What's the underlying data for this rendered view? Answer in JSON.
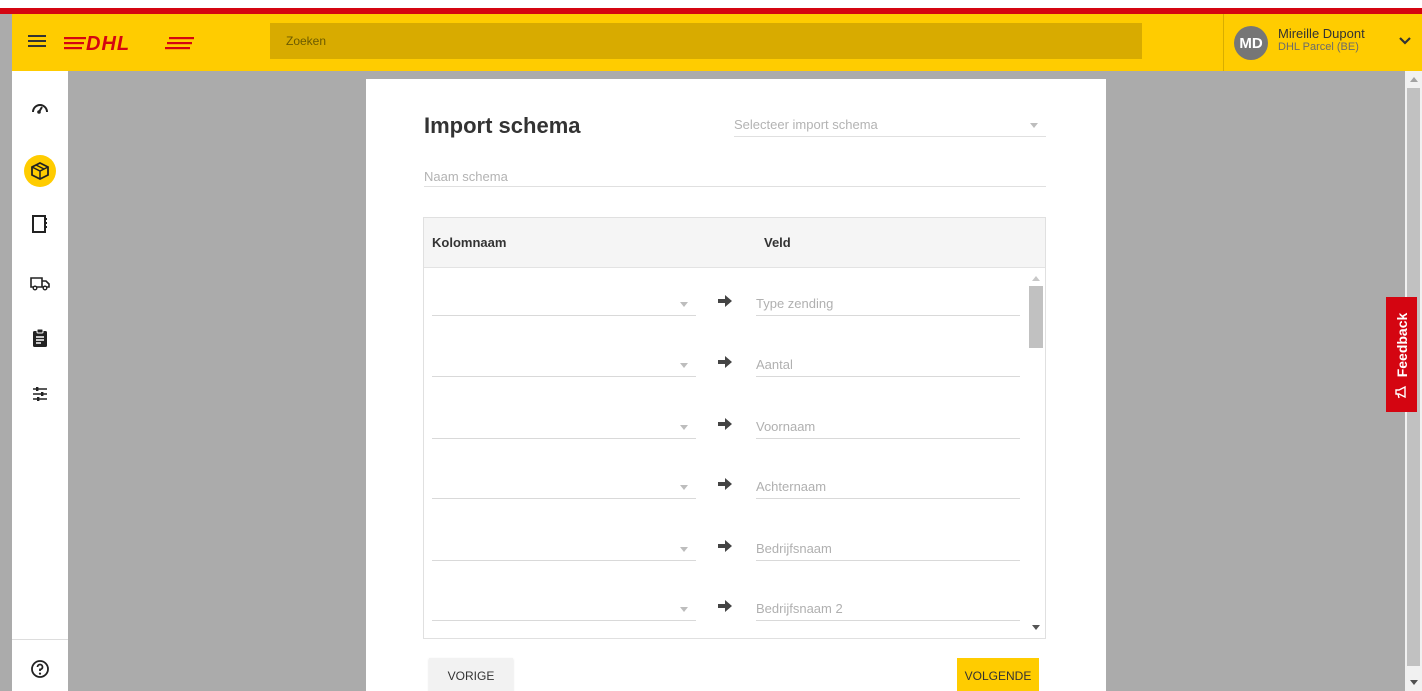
{
  "header": {
    "logo_text": "DHL",
    "search_placeholder": "Zoeken",
    "user": {
      "initials": "MD",
      "name": "Mireille Dupont",
      "organization": "DHL Parcel (BE)"
    }
  },
  "sidebar": {
    "items": [
      {
        "name": "dashboard",
        "icon": "speedometer-icon"
      },
      {
        "name": "shipments",
        "icon": "package-icon",
        "active": true
      },
      {
        "name": "address-book",
        "icon": "book-icon"
      },
      {
        "name": "pickups",
        "icon": "truck-icon"
      },
      {
        "name": "reports",
        "icon": "clipboard-icon"
      },
      {
        "name": "settings",
        "icon": "sliders-icon"
      }
    ],
    "footer_icon": "help-icon"
  },
  "form": {
    "title": "Import schema",
    "schema_select_placeholder": "Selecteer import schema",
    "name_placeholder": "Naam schema",
    "table": {
      "headers": {
        "column": "Kolomnaam",
        "field": "Veld"
      },
      "rows": [
        {
          "field": "Type zending"
        },
        {
          "field": "Aantal"
        },
        {
          "field": "Voornaam"
        },
        {
          "field": "Achternaam"
        },
        {
          "field": "Bedrijfsnaam"
        },
        {
          "field": "Bedrijfsnaam 2"
        }
      ]
    },
    "buttons": {
      "previous": "VORIGE",
      "next": "VOLGENDE"
    }
  },
  "feedback_label": "Feedback",
  "colors": {
    "brand_yellow": "#ffcc00",
    "brand_red": "#d40511"
  }
}
